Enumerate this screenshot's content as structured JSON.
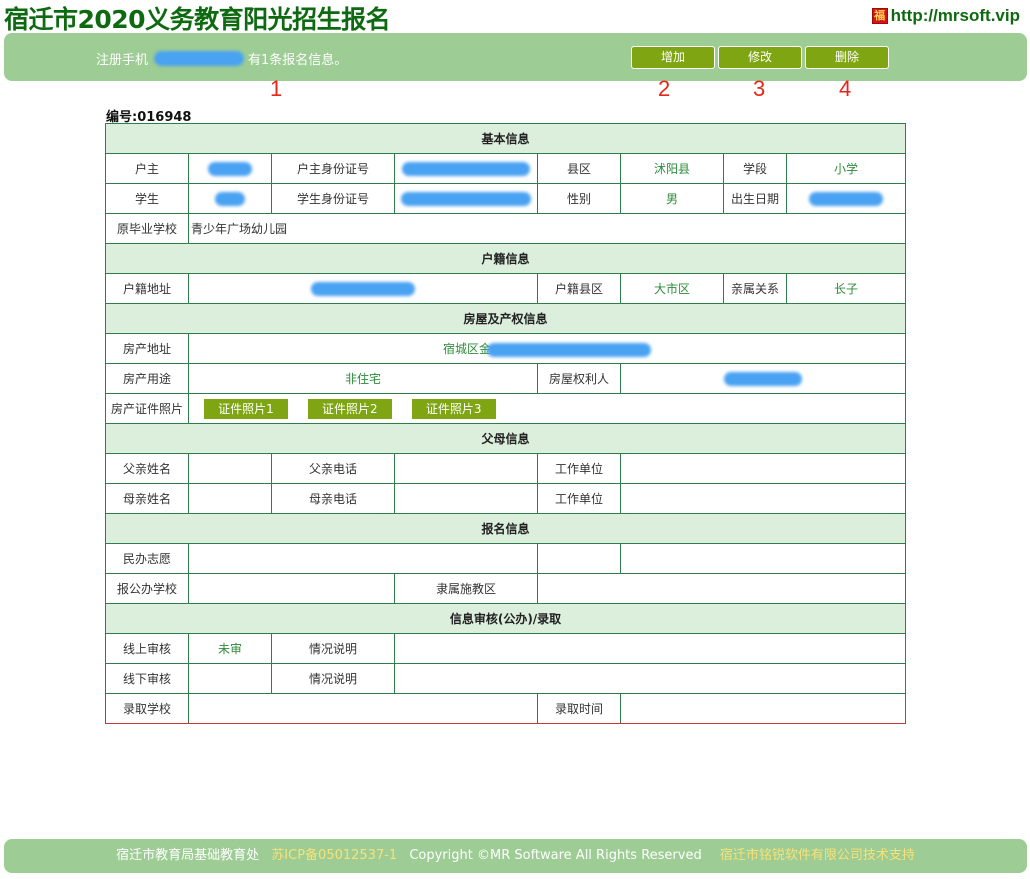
{
  "header": {
    "site_title": "宿迁市2020义务教育阳光招生报名",
    "site_link": "http://mrsoft.vip",
    "logo_char": "福"
  },
  "top_bar": {
    "notice_prefix": "注册手机",
    "notice_suffix": "有1条报名信息。",
    "buttons": {
      "add": "增加",
      "edit": "修改",
      "delete": "删除"
    }
  },
  "markers": [
    "1",
    "2",
    "3",
    "4"
  ],
  "record": {
    "id_label": "编号:016948"
  },
  "sections": {
    "basic": {
      "title": "基本信息",
      "householder_label": "户主",
      "householder_id_label": "户主身份证号",
      "district_label": "县区",
      "district_value": "沭阳县",
      "stage_label": "学段",
      "stage_value": "小学",
      "student_label": "学生",
      "student_id_label": "学生身份证号",
      "gender_label": "性别",
      "gender_value": "男",
      "birth_label": "出生日期",
      "prev_school_label": "原毕业学校",
      "prev_school_value": "青少年广场幼儿园"
    },
    "household": {
      "title": "户籍信息",
      "address_label": "户籍地址",
      "district_label": "户籍县区",
      "district_value": "大市区",
      "relation_label": "亲属关系",
      "relation_value": "长子"
    },
    "property": {
      "title": "房屋及产权信息",
      "address_label": "房产地址",
      "address_value": "宿城区金",
      "usage_label": "房产用途",
      "usage_value": "非住宅",
      "owner_label": "房屋权利人",
      "photos_label": "房产证件照片",
      "photo_buttons": [
        "证件照片1",
        "证件照片2",
        "证件照片3"
      ]
    },
    "parents": {
      "title": "父母信息",
      "father_name_label": "父亲姓名",
      "father_phone_label": "父亲电话",
      "mother_name_label": "母亲姓名",
      "mother_phone_label": "母亲电话",
      "work_unit_label": "工作单位"
    },
    "enroll": {
      "title": "报名信息",
      "private_label": "民办志愿",
      "public_label": "报公办学校",
      "area_label": "隶属施教区"
    },
    "review": {
      "title": "信息审核(公办)/录取",
      "online_label": "线上审核",
      "online_value": "未审",
      "explain_label": "情况说明",
      "offline_label": "线下审核",
      "school_label": "录取学校",
      "time_label": "录取时间"
    }
  },
  "footer": {
    "org": "宿迁市教育局基础教育处",
    "icp": "苏ICP备05012537-1",
    "copyright": "Copyright ©MR Software All Rights Reserved",
    "support": "宿迁市铭锐软件有限公司技术支持"
  },
  "colors": {
    "brand_green": "#0e6a10",
    "bar_green": "#9dcc94",
    "button_olive": "#7fa612",
    "section_bg": "#dcefdd",
    "value_green": "#2e8b3a",
    "marker_red": "#e5261a",
    "redaction_blue": "#49a2f2"
  }
}
